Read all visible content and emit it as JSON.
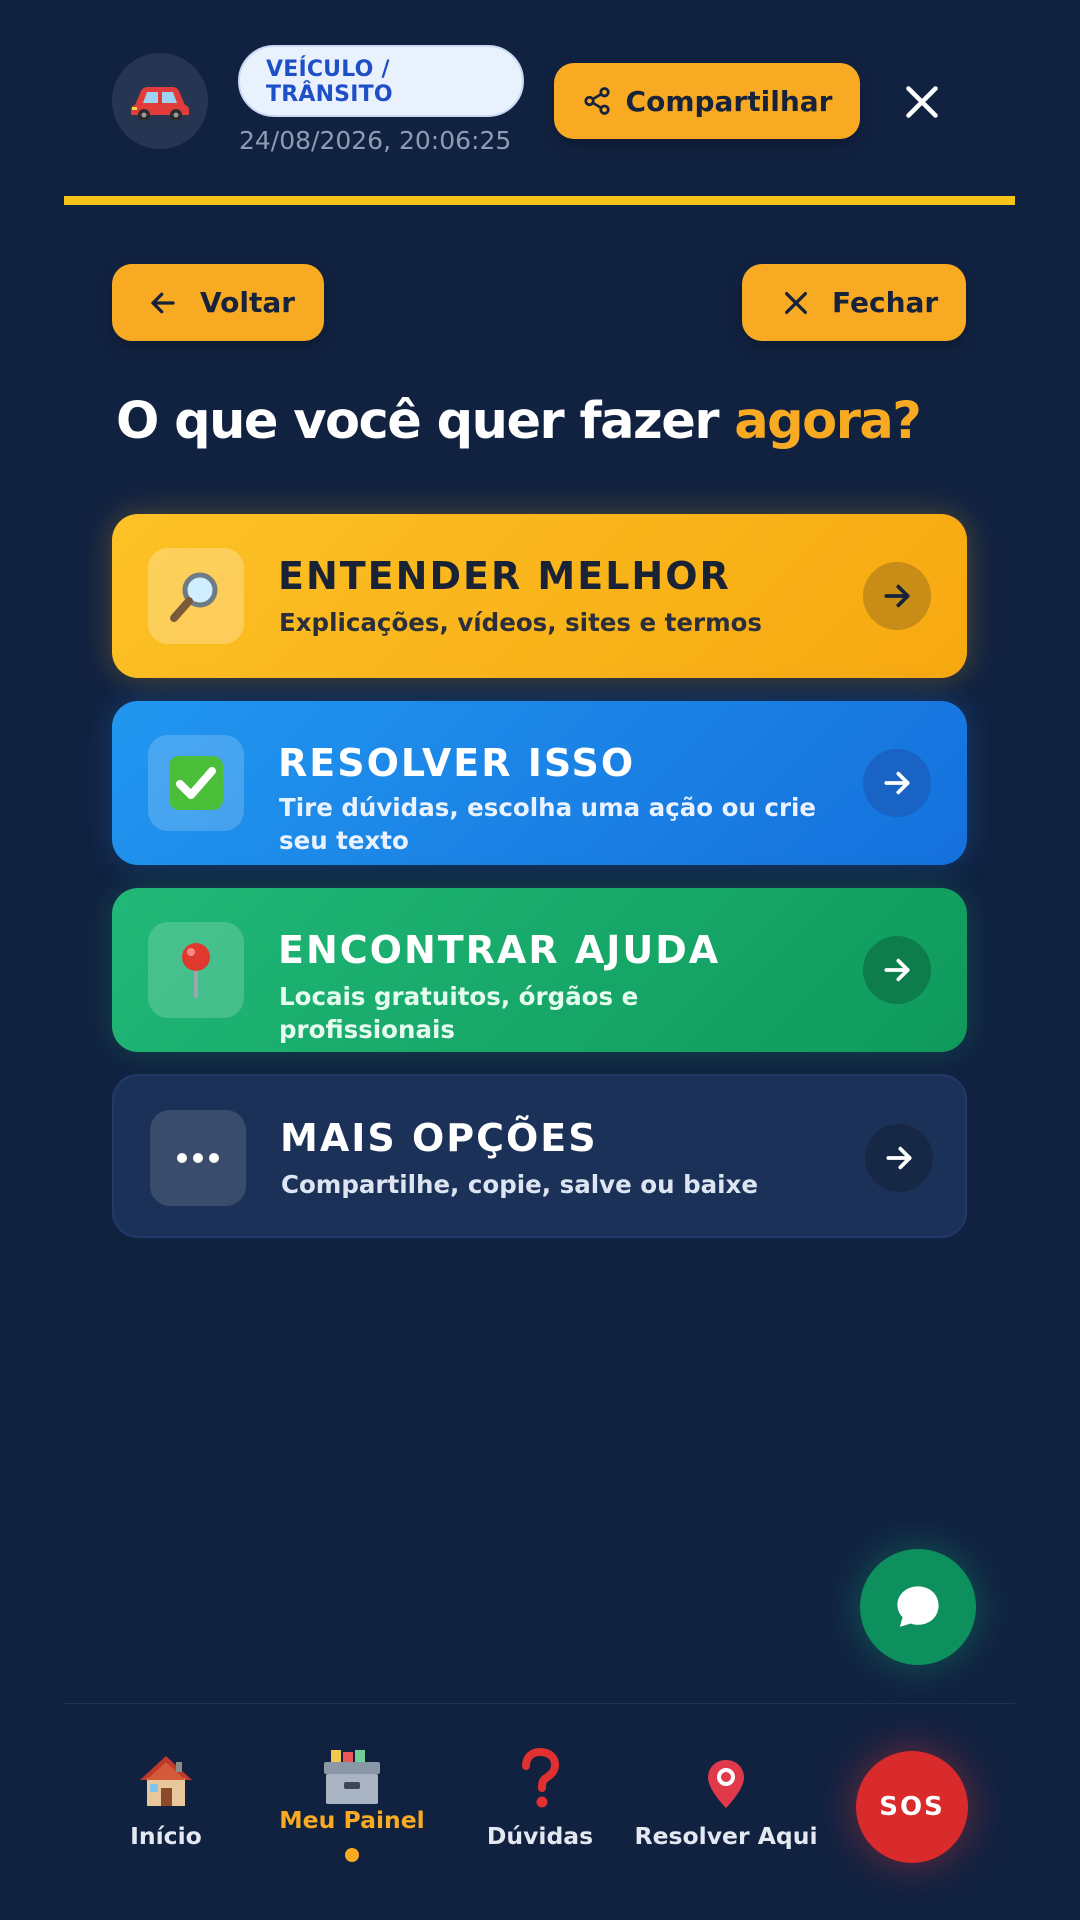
{
  "header": {
    "category_icon": "car-icon",
    "category_badge": "VEÍCULO / TRÂNSITO",
    "timestamp": "24/08/2026, 20:06:25",
    "share_label": "Compartilhar",
    "share_icon": "share-icon",
    "close_icon": "close-icon",
    "divider_color": "#f6c417"
  },
  "nav": {
    "back_label": "Voltar",
    "close_label": "Fechar"
  },
  "page": {
    "title_main": "O que você quer fazer ",
    "title_accent": "agora?"
  },
  "options": [
    {
      "title": "ENTENDER MELHOR",
      "subtitle": "Explicações, vídeos, sites e termos",
      "icon": "magnifying-glass-icon",
      "color": "#f8aa23"
    },
    {
      "title": "RESOLVER ISSO",
      "subtitle": "Tire dúvidas, escolha uma ação ou crie seu texto",
      "icon": "check-mark-icon",
      "color": "#1c86e8"
    },
    {
      "title": "ENCONTRAR AJUDA",
      "subtitle": "Locais gratuitos, órgãos e profissionais",
      "icon": "pin-icon",
      "color": "#18a96a"
    },
    {
      "title": "MAIS OPÇÕES",
      "subtitle": "Compartilhe, copie, salve ou baixe",
      "icon": "more-dots-icon",
      "color": "#1b3157"
    }
  ],
  "chat_fab": {
    "icon": "chat-bubble-icon",
    "color": "#0e8f5e"
  },
  "bottom_nav": {
    "items": [
      {
        "label": "Início",
        "icon": "house-icon"
      },
      {
        "label": "Meu Painel",
        "icon": "card-file-box-icon",
        "active": true
      },
      {
        "label": "Dúvidas",
        "icon": "question-mark-icon"
      },
      {
        "label": "Resolver Aqui",
        "icon": "location-pin-icon"
      }
    ],
    "sos_label": "SOS",
    "accent_color": "#f8aa23",
    "sos_color": "#d92b2b"
  }
}
